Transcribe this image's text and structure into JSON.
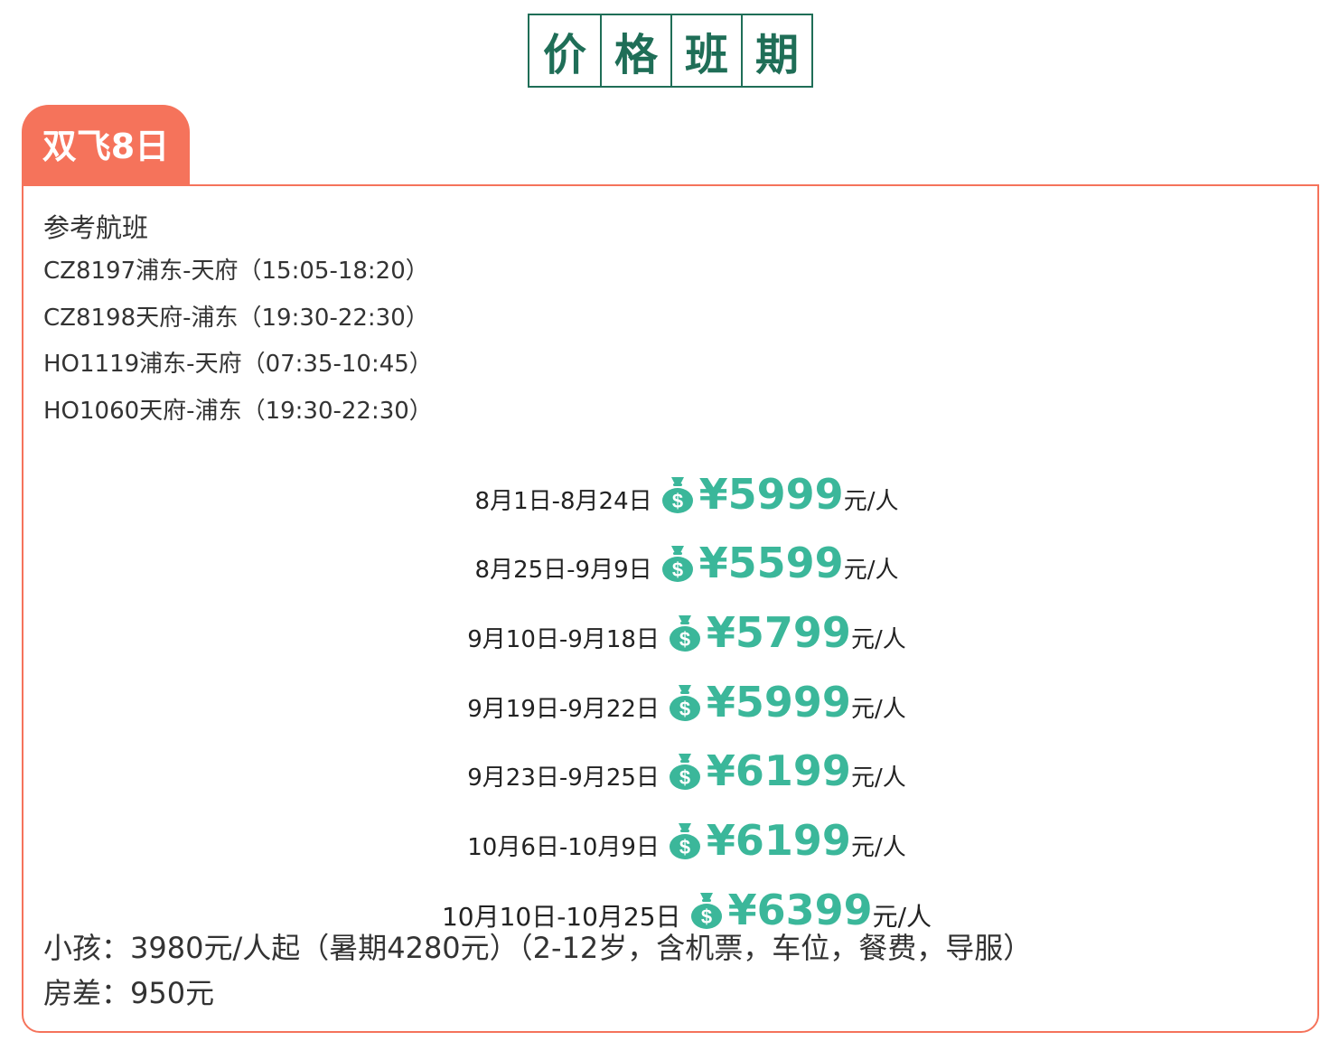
{
  "header": {
    "chars": [
      "价",
      "格",
      "班",
      "期"
    ],
    "color": "#1f6e57"
  },
  "tab": {
    "label": "双飞8日",
    "color": "#f5735b"
  },
  "flights": {
    "title": "参考航班",
    "items": [
      "CZ8197浦东-天府（15:05-18:20）",
      "CZ8198天府-浦东（19:30-22:30）",
      "HO1119浦东-天府（07:35-10:45）",
      "HO1060天府-浦东（19:30-22:30）"
    ]
  },
  "prices": {
    "icon": "money-bag-icon",
    "accent_color": "#3bb79a",
    "unit": "元/人",
    "rows": [
      {
        "date": "8月1日-8月24日",
        "price": "¥5999"
      },
      {
        "date": "8月25日-9月9日",
        "price": "¥5599"
      },
      {
        "date": "9月10日-9月18日",
        "price": "¥5799"
      },
      {
        "date": "9月19日-9月22日",
        "price": "¥5999"
      },
      {
        "date": "9月23日-9月25日",
        "price": "¥6199"
      },
      {
        "date": "10月6日-10月9日",
        "price": "¥6199"
      },
      {
        "date": "10月10日-10月25日",
        "price": "¥6399"
      }
    ]
  },
  "notes": {
    "child": "小孩：3980元/人起（暑期4280元）（2-12岁，含机票，车位，餐费，导服）",
    "room": "房差：950元"
  }
}
